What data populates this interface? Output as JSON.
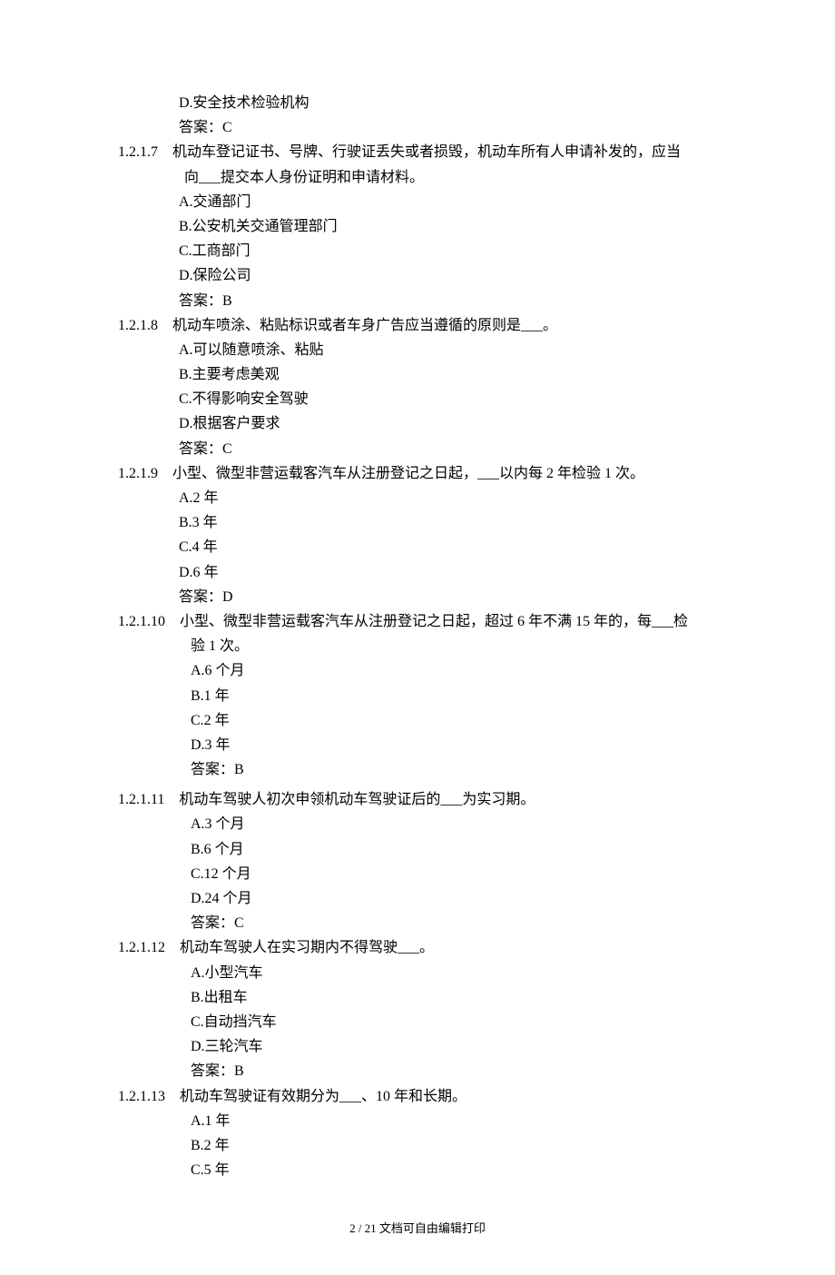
{
  "pre_options": {
    "d": "D.安全技术检验机构",
    "answer": "答案：C"
  },
  "questions": [
    {
      "num": "1.2.1.7",
      "text": "机动车登记证书、号牌、行驶证丢失或者损毁，机动车所有人申请补发的，应当",
      "continuation": "向___提交本人身份证明和申请材料。",
      "options": {
        "a": "A.交通部门",
        "b": "B.公安机关交通管理部门",
        "c": "C.工商部门",
        "d": "D.保险公司"
      },
      "answer": "答案：B"
    },
    {
      "num": "1.2.1.8",
      "text": "机动车喷涂、粘贴标识或者车身广告应当遵循的原则是___。",
      "options": {
        "a": "A.可以随意喷涂、粘贴",
        "b": "B.主要考虑美观",
        "c": "C.不得影响安全驾驶",
        "d": "D.根据客户要求"
      },
      "answer": "答案：C"
    },
    {
      "num": "1.2.1.9",
      "text": "小型、微型非营运载客汽车从注册登记之日起，___以内每 2 年检验 1 次。",
      "options": {
        "a": "A.2 年",
        "b": "B.3 年",
        "c": "C.4 年",
        "d": "D.6 年"
      },
      "answer": "答案：D"
    },
    {
      "num": "1.2.1.10",
      "text": "小型、微型非营运载客汽车从注册登记之日起，超过 6 年不满 15 年的，每___检",
      "continuation": "验 1 次。",
      "options": {
        "a": "A.6 个月",
        "b": "B.1 年",
        "c": "C.2 年",
        "d": "D.3 年"
      },
      "answer": "答案：B"
    },
    {
      "num": "1.2.1.11",
      "text": "机动车驾驶人初次申领机动车驾驶证后的___为实习期。",
      "options": {
        "a": "A.3 个月",
        "b": "B.6 个月",
        "c": "C.12 个月",
        "d": "D.24 个月"
      },
      "answer": "答案：C"
    },
    {
      "num": "1.2.1.12",
      "text": "机动车驾驶人在实习期内不得驾驶___。",
      "options": {
        "a": "A.小型汽车",
        "b": "B.出租车",
        "c": "C.自动挡汽车",
        "d": "D.三轮汽车"
      },
      "answer": "答案：B"
    },
    {
      "num": "1.2.1.13",
      "text": "机动车驾驶证有效期分为___、10 年和长期。",
      "options": {
        "a": "A.1 年",
        "b": "B.2 年",
        "c": "C.5 年"
      },
      "answer": null
    }
  ],
  "footer": "2 / 21 文档可自由编辑打印"
}
